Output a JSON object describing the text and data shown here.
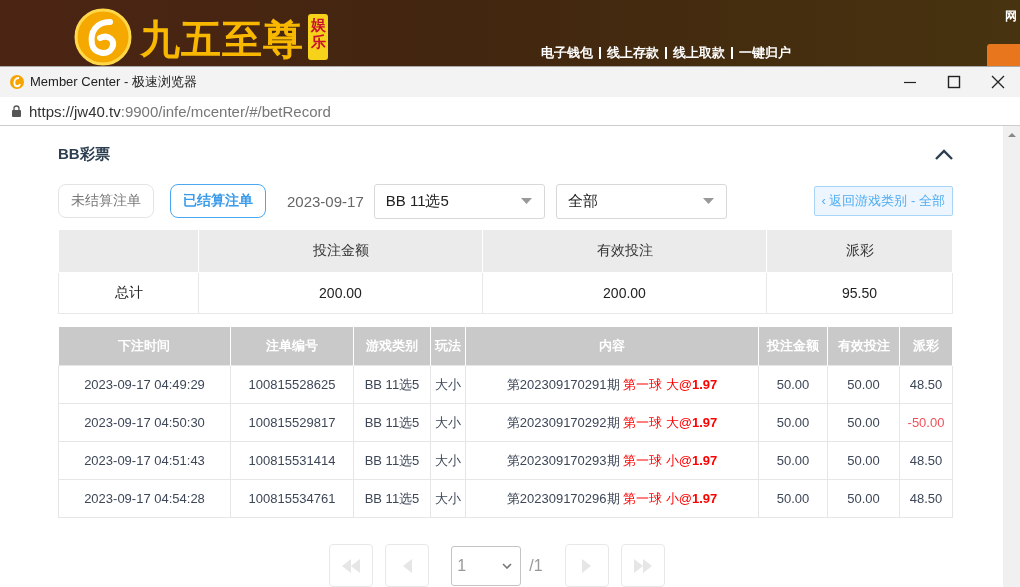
{
  "site_header": {
    "logo_text": "九五至尊",
    "badge": "娱乐",
    "nav_links": [
      "电子钱包",
      "线上存款",
      "线上取款",
      "一键归户"
    ],
    "top_right": "网"
  },
  "window": {
    "title": "Member Center - 极速浏览器",
    "url_host": "https://jw40.tv",
    "url_path": ":9900/infe/mcenter/#/betRecord"
  },
  "panel": {
    "title": "BB彩票",
    "expanded": true
  },
  "tabs": [
    {
      "label": "未结算注单",
      "selected": false
    },
    {
      "label": "已结算注单",
      "selected": true
    }
  ],
  "filters": {
    "date": "2023-09-17",
    "game": "BB 11选5",
    "category": "全部",
    "back_button": "‹ 返回游戏类别 - 全部"
  },
  "summary": {
    "columns": [
      "投注金额",
      "有效投注",
      "派彩"
    ],
    "row_label": "总计",
    "values": [
      "200.00",
      "200.00",
      "95.50"
    ]
  },
  "bets": {
    "columns": [
      "下注时间",
      "注单编号",
      "游戏类别",
      "玩法",
      "内容",
      "投注金额",
      "有效投注",
      "派彩"
    ],
    "rows": [
      {
        "time": "2023-09-17 04:49:29",
        "number": "100815528625",
        "game": "BB 11选5",
        "play": "大小",
        "issue": "第202309170291期",
        "pick": "第一球 大@",
        "odds": "1.97",
        "amount": "50.00",
        "valid": "50.00",
        "payout": "48.50",
        "negative": false
      },
      {
        "time": "2023-09-17 04:50:30",
        "number": "100815529817",
        "game": "BB 11选5",
        "play": "大小",
        "issue": "第202309170292期",
        "pick": "第一球 大@",
        "odds": "1.97",
        "amount": "50.00",
        "valid": "50.00",
        "payout": "-50.00",
        "negative": true
      },
      {
        "time": "2023-09-17 04:51:43",
        "number": "100815531414",
        "game": "BB 11选5",
        "play": "大小",
        "issue": "第202309170293期",
        "pick": "第一球 小@",
        "odds": "1.97",
        "amount": "50.00",
        "valid": "50.00",
        "payout": "48.50",
        "negative": false
      },
      {
        "time": "2023-09-17 04:54:28",
        "number": "100815534761",
        "game": "BB 11选5",
        "play": "大小",
        "issue": "第202309170296期",
        "pick": "第一球 小@",
        "odds": "1.97",
        "amount": "50.00",
        "valid": "50.00",
        "payout": "48.50",
        "negative": false
      }
    ]
  },
  "pager": {
    "page": "1",
    "total": "/1",
    "buttons": [
      {
        "kind": "first",
        "disabled": true
      },
      {
        "kind": "prev",
        "disabled": true
      },
      {
        "kind": "next",
        "disabled": true
      },
      {
        "kind": "last",
        "disabled": true
      }
    ]
  }
}
